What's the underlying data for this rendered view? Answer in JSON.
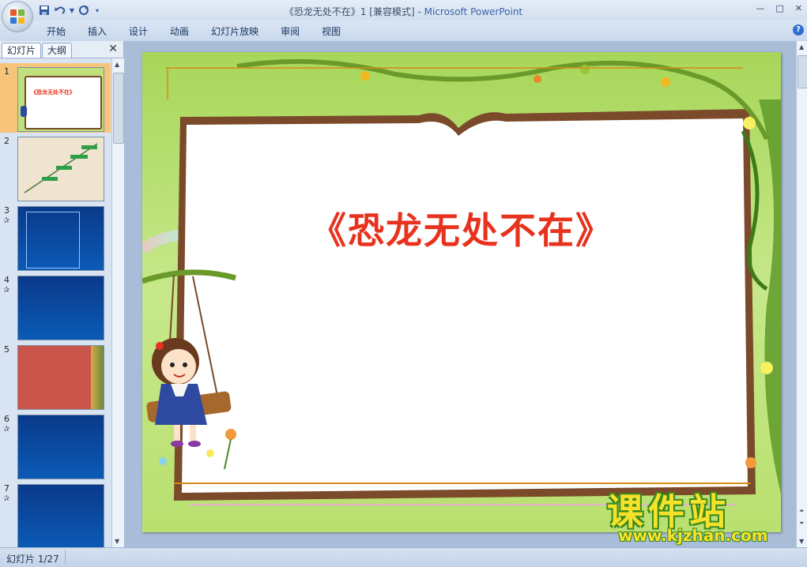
{
  "window": {
    "title": "《恐龙无处不在》1 [兼容模式] - ",
    "app_name": "Microsoft PowerPoint",
    "controls": [
      "—",
      "□",
      "✕"
    ]
  },
  "quick_access": [
    "save-icon",
    "undo-icon",
    "redo-icon",
    "customize-icon"
  ],
  "ribbon": {
    "tabs": [
      "开始",
      "插入",
      "设计",
      "动画",
      "幻灯片放映",
      "审阅",
      "视图"
    ],
    "help": "?"
  },
  "left_pane": {
    "tab_slides": "幻灯片",
    "tab_outline": "大纲",
    "close": "✕",
    "thumbnails": [
      {
        "number": "1",
        "has_animation": false,
        "title": "《恐龙无处不在》",
        "selected": true
      },
      {
        "number": "2",
        "has_animation": false,
        "selected": false
      },
      {
        "number": "3",
        "has_animation": true,
        "selected": false
      },
      {
        "number": "4",
        "has_animation": true,
        "selected": false
      },
      {
        "number": "5",
        "has_animation": false,
        "selected": false
      },
      {
        "number": "6",
        "has_animation": true,
        "selected": false
      },
      {
        "number": "7",
        "has_animation": true,
        "selected": false
      }
    ],
    "animation_mark": "✰"
  },
  "slide": {
    "title": "《恐龙无处不在》",
    "title_color": "#e8321e"
  },
  "status_bar": {
    "slide_indicator": "幻灯片 1/27"
  },
  "watermark": {
    "text": "课件站",
    "url": "www.kjzhan.com"
  },
  "colors": {
    "accent": "#3a66a8",
    "selection": "#f7c57a",
    "frame_green": "#8fc43c",
    "frame_brown": "#7a4a2a"
  }
}
